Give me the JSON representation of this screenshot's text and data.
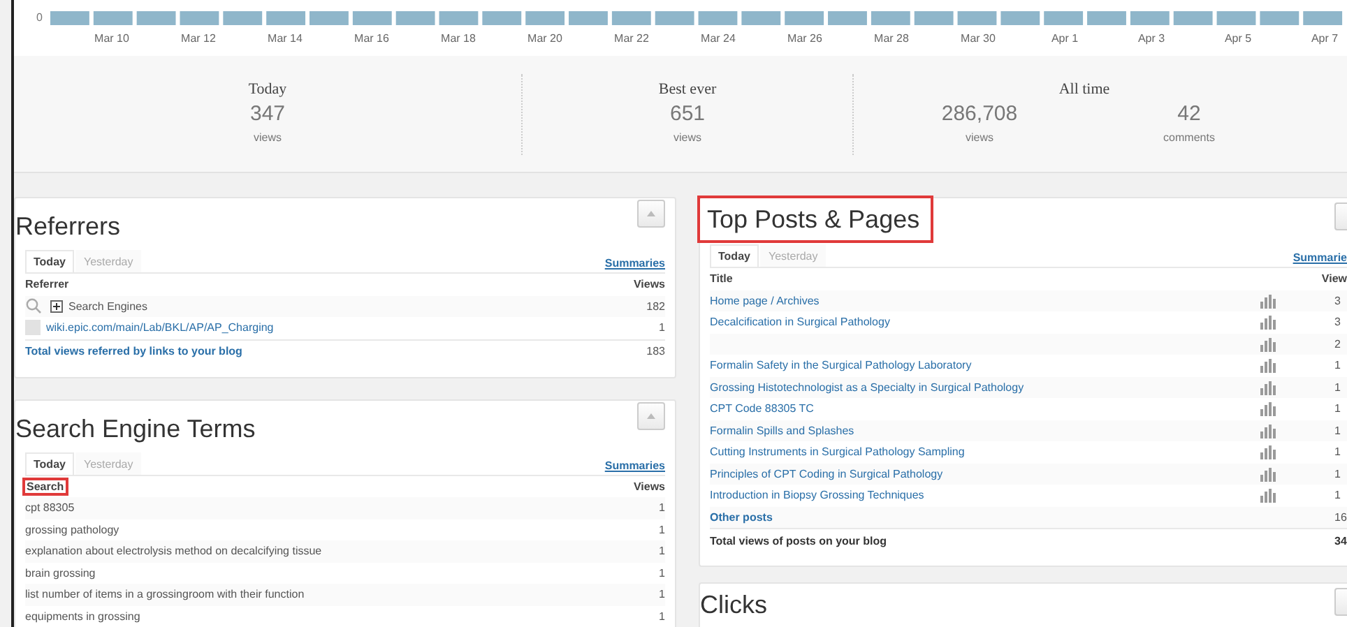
{
  "chart": {
    "y_label": "0",
    "x_labels": [
      "Mar 10",
      "Mar 12",
      "Mar 14",
      "Mar 16",
      "Mar 18",
      "Mar 20",
      "Mar 22",
      "Mar 24",
      "Mar 26",
      "Mar 28",
      "Mar 30",
      "Apr 1",
      "Apr 3",
      "Apr 5",
      "Apr 7"
    ]
  },
  "stats": [
    {
      "title": "Today",
      "items": [
        {
          "value": "347",
          "label": "views"
        }
      ]
    },
    {
      "title": "Best ever",
      "items": [
        {
          "value": "651",
          "label": "views"
        }
      ]
    },
    {
      "title": "All time",
      "items": [
        {
          "value": "286,708",
          "label": "views"
        },
        {
          "value": "42",
          "label": "comments"
        }
      ]
    }
  ],
  "referrers": {
    "title": "Referrers",
    "tabs": [
      {
        "label": "Today",
        "selected": true
      },
      {
        "label": "Yesterday",
        "selected": false
      }
    ],
    "summaries": "Summaries",
    "columns": [
      "Referrer",
      "Views"
    ],
    "rows": [
      {
        "kind": "group",
        "label": "Search Engines",
        "views": "182",
        "expanded": false
      },
      {
        "kind": "link",
        "label": "wiki.epic.com/main/Lab/BKL/AP/AP_Charging",
        "views": "1"
      }
    ],
    "total": {
      "label": "Total views referred by links to your blog",
      "views": "183"
    }
  },
  "search_terms": {
    "title": "Search Engine Terms",
    "tabs": [
      {
        "label": "Today",
        "selected": true
      },
      {
        "label": "Yesterday",
        "selected": false
      }
    ],
    "summaries": "Summaries",
    "columns": [
      {
        "label": "Search",
        "highlighted": true
      },
      {
        "label": "Views",
        "highlighted": false
      }
    ],
    "rows": [
      {
        "term": "cpt 88305",
        "views": "1"
      },
      {
        "term": "grossing pathology",
        "views": "1"
      },
      {
        "term": "explanation about electrolysis method on decalcifying tissue",
        "views": "1"
      },
      {
        "term": "brain grossing",
        "views": "1"
      },
      {
        "term": "list number of items in a grossingroom with their function",
        "views": "1"
      },
      {
        "term": "equipments in grossing",
        "views": "1"
      }
    ]
  },
  "top_posts": {
    "title": "Top Posts & Pages",
    "highlighted": true,
    "tabs": [
      {
        "label": "Today",
        "selected": true
      },
      {
        "label": "Yesterday",
        "selected": false
      }
    ],
    "summaries": "Summarie",
    "columns": [
      "Title",
      "View"
    ],
    "rows": [
      {
        "title": "Home page / Archives",
        "views": "3"
      },
      {
        "title": "Decalcification in Surgical Pathology",
        "views": "3"
      },
      {
        "views": "2"
      },
      {
        "title": "Formalin Safety in the Surgical Pathology Laboratory",
        "views": "1"
      },
      {
        "title": "Grossing Histotechnologist as a Specialty in Surgical Pathology",
        "views": "1"
      },
      {
        "title": "CPT Code 88305 TC",
        "views": "1"
      },
      {
        "title": "Formalin Spills and Splashes",
        "views": "1"
      },
      {
        "title": "Cutting Instruments in Surgical Pathology Sampling",
        "views": "1"
      },
      {
        "title": "Principles of CPT Coding in Surgical Pathology",
        "views": "1"
      },
      {
        "title": "Introduction in Biopsy Grossing Techniques",
        "views": "1"
      }
    ],
    "other": {
      "label": "Other posts",
      "views": "16"
    },
    "total": {
      "label": "Total views of posts on your blog",
      "views": "34"
    }
  },
  "clicks": {
    "title": "Clicks"
  }
}
